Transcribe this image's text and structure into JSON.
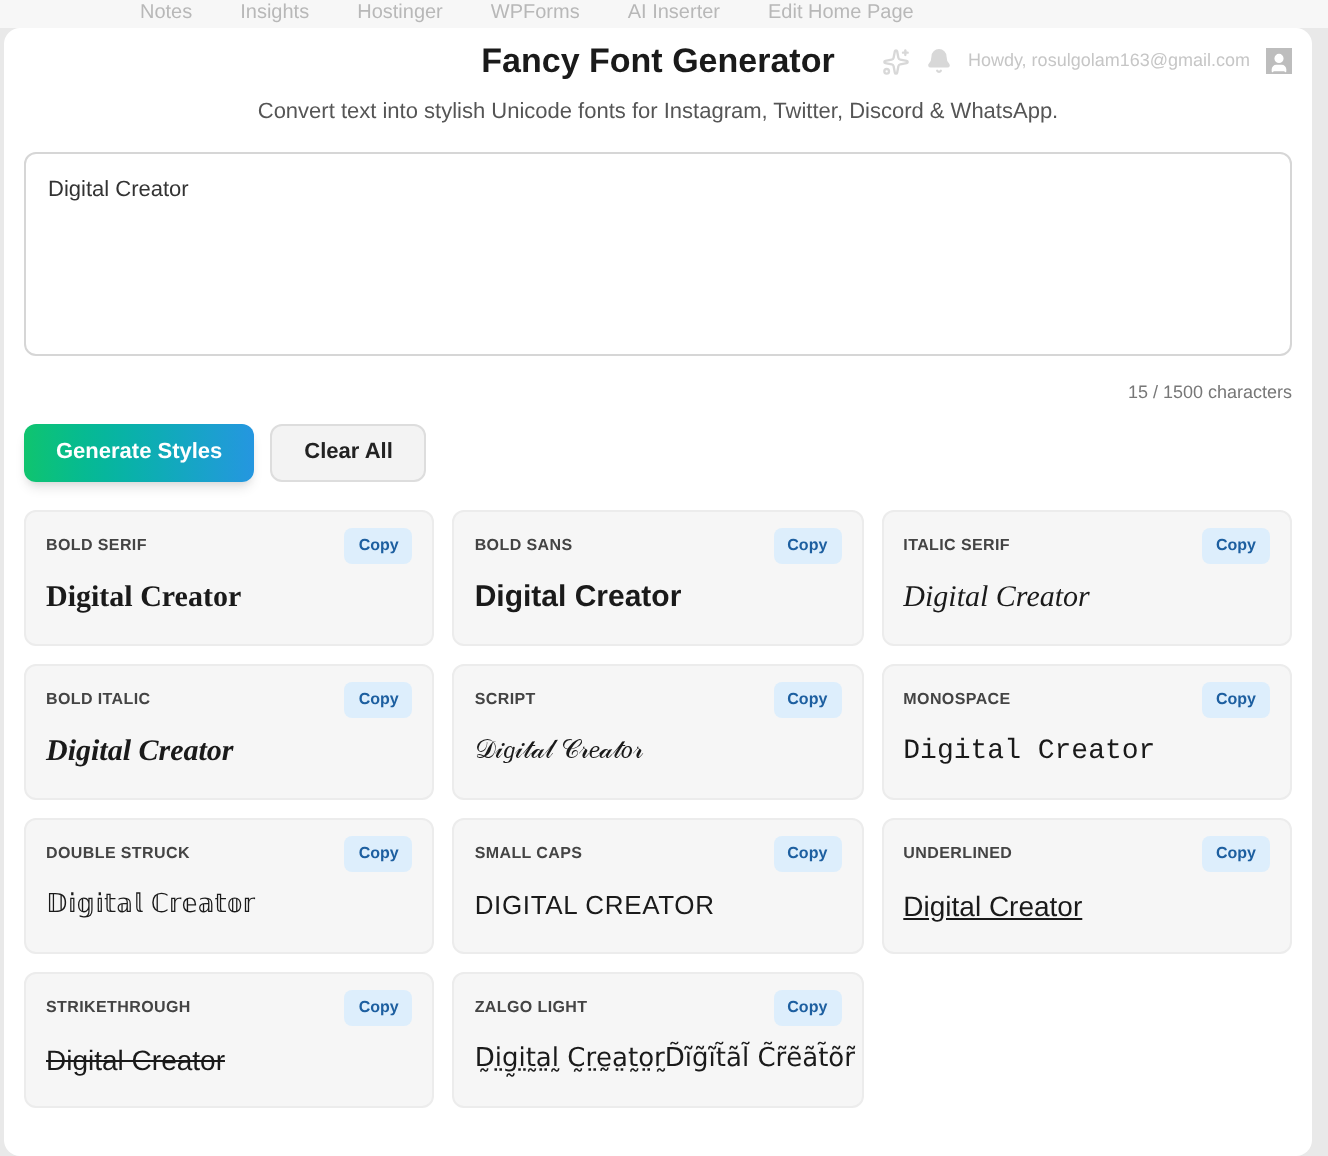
{
  "admin_bar": {
    "items": [
      "Notes",
      "Insights",
      "Hostinger",
      "WPForms",
      "AI Inserter",
      "Edit Home Page"
    ],
    "greeting": "Howdy, rosulgolam163@gmail.com"
  },
  "header": {
    "title": "Fancy Font Generator",
    "subtitle": "Convert text into stylish Unicode fonts for Instagram, Twitter, Discord & WhatsApp."
  },
  "input": {
    "value": "Digital Creator",
    "counter": "15 / 1500 characters"
  },
  "buttons": [
    {
      "label": "Generate Styles",
      "kind": "primary"
    },
    {
      "label": "Clear All",
      "kind": "secondary"
    }
  ],
  "styles": [
    {
      "name": "BOLD SERIF",
      "kind": "bold-serif",
      "sample": "Digital Creator",
      "copy": "Copy"
    },
    {
      "name": "BOLD SANS",
      "kind": "bold-sans",
      "sample": "Digital Creator",
      "copy": "Copy"
    },
    {
      "name": "ITALIC SERIF",
      "kind": "italic-serif",
      "sample": "Digital Creator",
      "copy": "Copy"
    },
    {
      "name": "BOLD ITALIC",
      "kind": "bold-italic",
      "sample": "Digital Creator",
      "copy": "Copy"
    },
    {
      "name": "SCRIPT",
      "kind": "plain",
      "sample": "𝒟𝒾𝑔𝒾𝓉𝒶𝓁 𝒞𝓇𝑒𝒶𝓉𝑜𝓇",
      "copy": "Copy"
    },
    {
      "name": "MONOSPACE",
      "kind": "mono",
      "sample": "Digital Creator",
      "copy": "Copy"
    },
    {
      "name": "DOUBLE STRUCK",
      "kind": "plain",
      "sample": "𝔻𝕚𝕘𝕚𝕥𝕒𝕝 ℂ𝕣𝕖𝕒𝕥𝕠𝕣",
      "copy": "Copy"
    },
    {
      "name": "SMALL CAPS",
      "kind": "caps",
      "sample": "DIGITAL CREATOR",
      "copy": "Copy"
    },
    {
      "name": "UNDERLINED",
      "kind": "underline",
      "sample": "Digital Creator",
      "copy": "Copy"
    },
    {
      "name": "STRIKETHROUGH",
      "kind": "strike",
      "sample": "Digital Creator",
      "copy": "Copy"
    },
    {
      "name": "ZALGO LIGHT",
      "kind": "plain",
      "sample": "D̰i̤g̰i̤t̰a̤l̰ C̰r̤ḛa̤t̰o̤r̰D̃ĩg̃ĩt̃ãl̃ C̃r̃ẽãt̃õr̃",
      "copy": "Copy"
    }
  ]
}
